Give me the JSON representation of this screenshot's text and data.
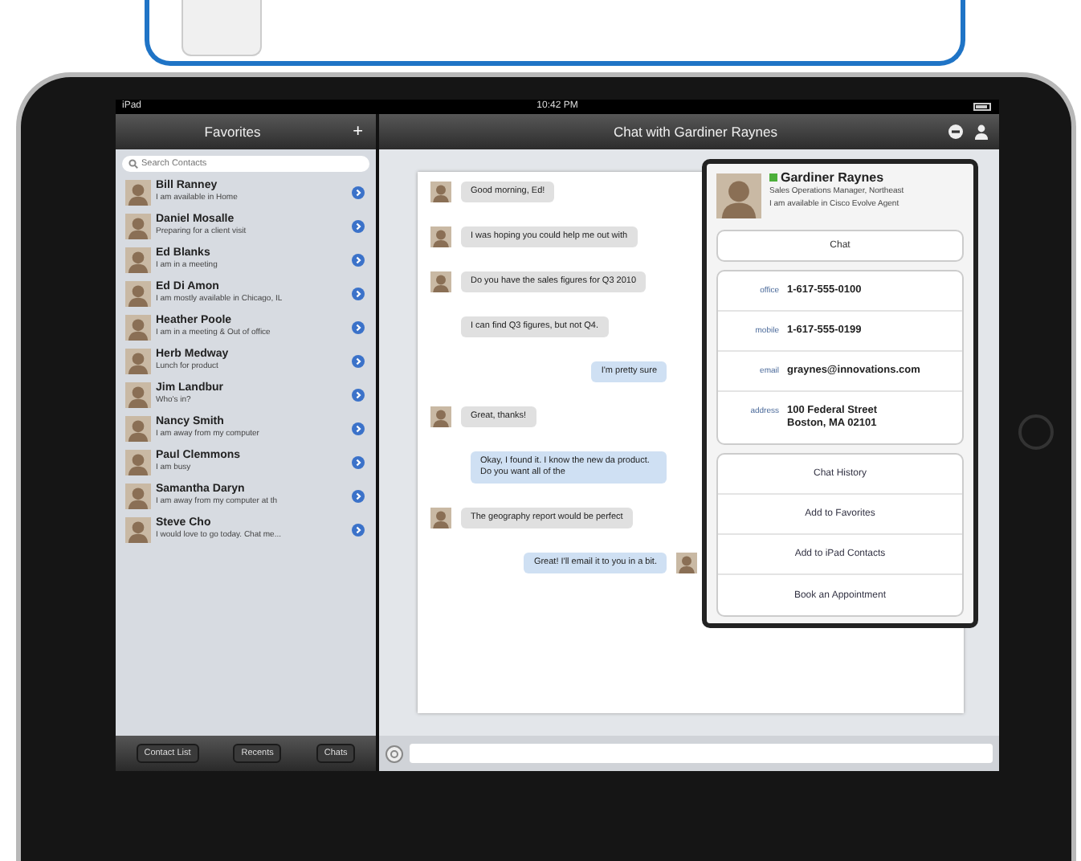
{
  "status_bar": {
    "carrier": "iPad",
    "time": "10:42 PM"
  },
  "sidebar": {
    "title": "Favorites",
    "add": "+",
    "search": {
      "placeholder": "Search Contacts"
    },
    "contacts": [
      {
        "name": "Bill Ranney",
        "status": "I am available in Home"
      },
      {
        "name": "Daniel Mosalle",
        "status": "Preparing for a client visit"
      },
      {
        "name": "Ed Blanks",
        "status": "I am in a meeting"
      },
      {
        "name": "Ed Di Amon",
        "status": "I am mostly available in Chicago, IL"
      },
      {
        "name": "Heather Poole",
        "status": "I am in a meeting & Out of office"
      },
      {
        "name": "Herb Medway",
        "status": "Lunch for product"
      },
      {
        "name": "Jim Landbur",
        "status": "Who's in?"
      },
      {
        "name": "Nancy Smith",
        "status": "I am away from my computer"
      },
      {
        "name": "Paul Clemmons",
        "status": "I am busy"
      },
      {
        "name": "Samantha Daryn",
        "status": "I am away from my computer at th"
      },
      {
        "name": "Steve Cho",
        "status": "I would love to go today. Chat me..."
      }
    ],
    "toolbar": [
      {
        "label": "Contact List",
        "selected": false
      },
      {
        "label": "Recents",
        "selected": false
      },
      {
        "label": "Chats",
        "selected": false
      }
    ]
  },
  "chat": {
    "title": "Chat with Gardiner Raynes",
    "messages": [
      {
        "kind": "incoming",
        "text": "Good morning, Ed!",
        "avatar": true
      },
      {
        "kind": "incoming",
        "text": "I was hoping you could help me out with",
        "avatar": true
      },
      {
        "kind": "incoming",
        "text": "Do you have the sales figures for Q3 2010",
        "avatar": true
      },
      {
        "kind": "incoming",
        "text": "I can find Q3 figures, but not Q4.",
        "avatar": false
      },
      {
        "kind": "outgoing",
        "text": "I'm pretty sure",
        "avatar": false
      },
      {
        "kind": "incoming",
        "text": "Great, thanks!",
        "avatar": true
      },
      {
        "kind": "outgoing",
        "text": "Okay, I found it. I know the new da product. Do you want all of the",
        "avatar": false
      },
      {
        "kind": "incoming",
        "text": "The geography report would be perfect",
        "avatar": true
      },
      {
        "kind": "outgoing",
        "text": "Great! I'll email it to you in a bit.",
        "avatar": true
      }
    ]
  },
  "contact_card": {
    "name": "Gardiner Raynes",
    "online": true,
    "title": "Sales Operations Manager, Northeast",
    "status": "I am available in Cisco Evolve Agent",
    "chat_button": "Chat",
    "fields": [
      {
        "label": "office",
        "value": "1-617-555-0100"
      },
      {
        "label": "mobile",
        "value": "1-617-555-0199"
      },
      {
        "label": "email",
        "value": "graynes@innovations.com"
      },
      {
        "label": "address",
        "value": "100 Federal Street\nBoston, MA 02101"
      }
    ],
    "actions": [
      "Chat History",
      "Add to Favorites",
      "Add to iPad Contacts",
      "Book an Appointment"
    ]
  }
}
